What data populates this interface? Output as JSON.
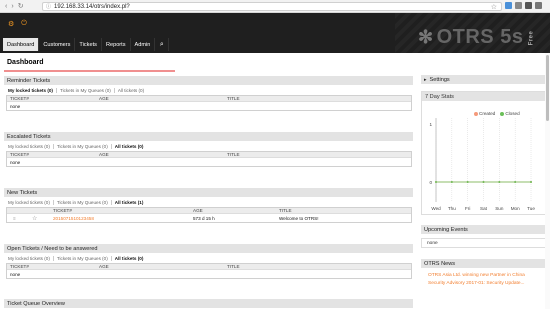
{
  "browser": {
    "url": "192.168.33.14/otrs/index.pl?"
  },
  "header": {
    "logo": "OTRS 5s",
    "logo_tag": "Free",
    "nav": [
      {
        "label": "Dashboard"
      },
      {
        "label": "Customers"
      },
      {
        "label": "Tickets"
      },
      {
        "label": "Reports"
      },
      {
        "label": "Admin"
      }
    ]
  },
  "page": {
    "title": "Dashboard"
  },
  "columns": {
    "ticket": "TICKET#",
    "age": "AGE",
    "title": "TITLE"
  },
  "widgets": {
    "reminder": {
      "title": "Reminder Tickets",
      "filters": [
        "My locked tickets (0)",
        "Tickets in My Queues (0)",
        "All tickets (0)"
      ],
      "empty": "none"
    },
    "escalated": {
      "title": "Escalated Tickets",
      "filters": [
        "My locked tickets (0)",
        "Tickets in My Queues (0)",
        "All tickets (0)"
      ],
      "empty": "none"
    },
    "new": {
      "title": "New Tickets",
      "filters": [
        "My locked tickets (0)",
        "Tickets in My Queues (0)",
        "All tickets (1)"
      ],
      "row": {
        "ticket": "2015071510123458",
        "age": "573 d 15 h",
        "title": "Welcome to OTRS!"
      }
    },
    "open": {
      "title": "Open Tickets / Need to be answered",
      "filters": [
        "My locked tickets (0)",
        "Tickets in My Queues (0)",
        "All tickets (0)"
      ],
      "empty": "none"
    },
    "queue_overview": {
      "title": "Ticket Queue Overview"
    }
  },
  "sidebar": {
    "settings": "Settings",
    "stats": {
      "title": "7 Day Stats",
      "legend": [
        "Created",
        "Closed"
      ],
      "y_top": "1",
      "y_zero": "0",
      "days": [
        "Wed",
        "Thu",
        "Fri",
        "Sat",
        "Sun",
        "Mon",
        "Tue"
      ]
    },
    "upcoming": {
      "title": "Upcoming Events",
      "empty": "none"
    },
    "news": {
      "title": "OTRS News",
      "items": [
        "OTRS Asia Ltd. winning new Partner in China",
        "Security Advisory 2017-01: Security Update..."
      ]
    }
  },
  "colors": {
    "accent": "#f27d2d",
    "created": "#f59a7b",
    "closed": "#6bbf59",
    "header_bg": "#1f1f1f"
  },
  "chart_data": {
    "type": "line",
    "x": [
      "Wed",
      "Thu",
      "Fri",
      "Sat",
      "Sun",
      "Mon",
      "Tue"
    ],
    "series": [
      {
        "name": "Created",
        "values": [
          0,
          0,
          0,
          0,
          0,
          0,
          0
        ]
      },
      {
        "name": "Closed",
        "values": [
          0,
          0,
          0,
          0,
          0,
          0,
          0
        ]
      }
    ],
    "ylim": [
      0,
      1
    ]
  }
}
